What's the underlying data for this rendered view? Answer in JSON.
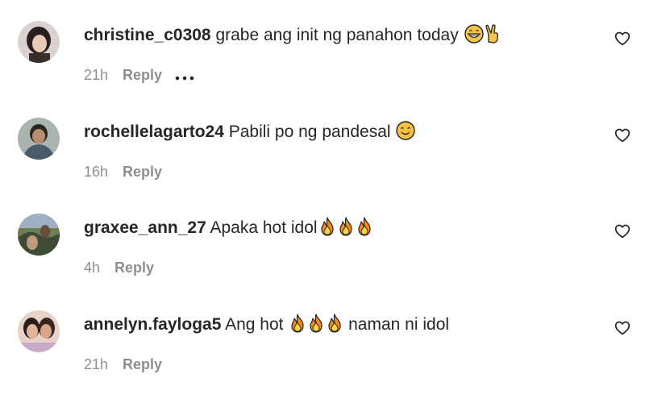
{
  "comments": [
    {
      "username": "christine_c0308",
      "text": " grabe ang init ng panahon today ",
      "emoji": [
        "grinning-face-icon",
        "victory-hand-icon"
      ],
      "time": "21h",
      "reply_label": "Reply",
      "more_icon": "more-icon",
      "like_icon": "heart-icon"
    },
    {
      "username": "rochellelagarto24",
      "text": " Pabili po ng pandesal ",
      "emoji": [
        "smiling-face-icon"
      ],
      "time": "16h",
      "reply_label": "Reply",
      "like_icon": "heart-icon"
    },
    {
      "username": "graxee_ann_27",
      "text": " Apaka hot idol",
      "emoji": [
        "fire-icon",
        "fire-icon",
        "fire-icon"
      ],
      "time": "4h",
      "reply_label": "Reply",
      "like_icon": "heart-icon"
    },
    {
      "username": "annelyn.fayloga5",
      "text": " Ang hot ",
      "text_after": " naman ni idol",
      "emoji": [
        "fire-icon",
        "fire-icon",
        "fire-icon"
      ],
      "time": "21h",
      "reply_label": "Reply",
      "like_icon": "heart-icon"
    }
  ],
  "colors": {
    "text": "#262626",
    "secondary": "#8e8e8e",
    "background": "#ffffff"
  }
}
